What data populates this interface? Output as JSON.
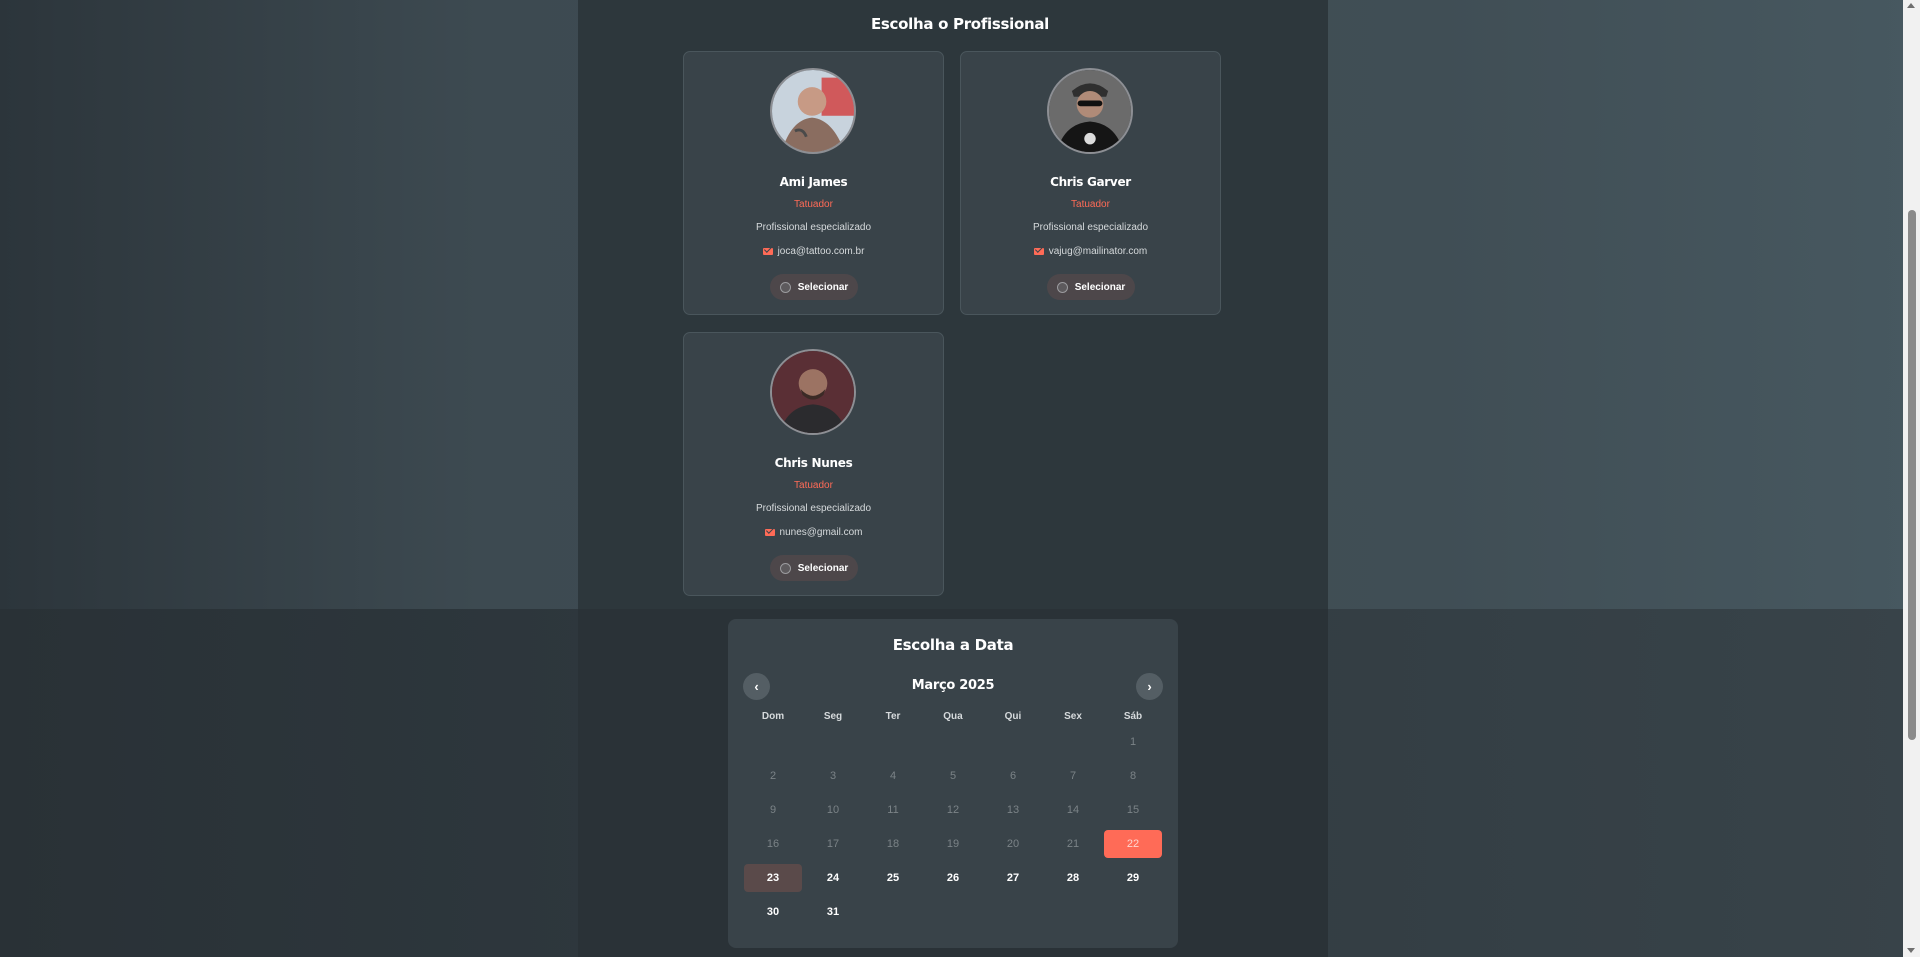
{
  "professionals_section": {
    "title": "Escolha o Profissional"
  },
  "professionals": [
    {
      "name": "Ami James",
      "role": "Tatuador",
      "description": "Profissional especializado",
      "email": "joca@tattoo.com.br",
      "select_label": "Selecionar"
    },
    {
      "name": "Chris Garver",
      "role": "Tatuador",
      "description": "Profissional especializado",
      "email": "vajug@mailinator.com",
      "select_label": "Selecionar"
    },
    {
      "name": "Chris Nunes",
      "role": "Tatuador",
      "description": "Profissional especializado",
      "email": "nunes@gmail.com",
      "select_label": "Selecionar"
    }
  ],
  "calendar": {
    "title": "Escolha a Data",
    "month_label": "Março 2025",
    "prev_icon": "‹",
    "next_icon": "›",
    "weekdays": [
      "Dom",
      "Seg",
      "Ter",
      "Qua",
      "Qui",
      "Sex",
      "Sáb"
    ],
    "selected_day": "22",
    "today_day": "23",
    "days": [
      [
        "",
        "",
        "",
        "",
        "",
        "",
        "1"
      ],
      [
        "2",
        "3",
        "4",
        "5",
        "6",
        "7",
        "8"
      ],
      [
        "9",
        "10",
        "11",
        "12",
        "13",
        "14",
        "15"
      ],
      [
        "16",
        "17",
        "18",
        "19",
        "20",
        "21",
        "22"
      ],
      [
        "23",
        "24",
        "25",
        "26",
        "27",
        "28",
        "29"
      ],
      [
        "30",
        "31",
        "",
        "",
        "",
        "",
        ""
      ]
    ]
  },
  "colors": {
    "accent": "#ff6b57",
    "card": "#394349",
    "today": "#5a4a4a"
  }
}
